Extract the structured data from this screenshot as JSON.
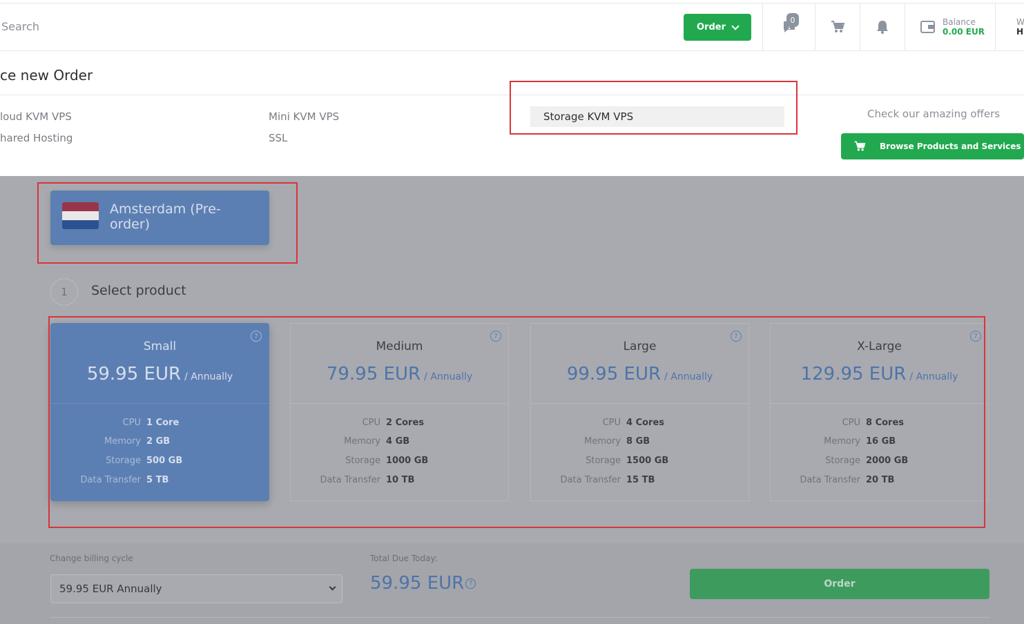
{
  "header": {
    "search_placeholder": "Search",
    "order_label": "Order",
    "messages_count": "0",
    "balance_label": "Balance",
    "balance_value": "0.00 EUR",
    "user_initial_top": "W",
    "user_initial_bottom": "H"
  },
  "page": {
    "title": "ce new Order"
  },
  "categories": {
    "col1": [
      "loud KVM VPS",
      "hared Hosting"
    ],
    "col2": [
      "Mini KVM VPS",
      "SSL"
    ],
    "active": "Storage KVM VPS"
  },
  "offers": {
    "text": "Check our amazing offers",
    "browse_label": "Browse Products and Services"
  },
  "location": {
    "name": "Amsterdam (Pre-order)",
    "flag_colors": [
      "#ae1c28",
      "#ffffff",
      "#21468b"
    ]
  },
  "step": {
    "number": "1",
    "title": "Select product"
  },
  "plans": [
    {
      "name": "Small",
      "price": "59.95 EUR",
      "period": "/ Annually",
      "cpu": "1 Core",
      "memory": "2 GB",
      "storage": "500 GB",
      "transfer": "5 TB"
    },
    {
      "name": "Medium",
      "price": "79.95 EUR",
      "period": "/ Annually",
      "cpu": "2 Cores",
      "memory": "4 GB",
      "storage": "1000 GB",
      "transfer": "10 TB"
    },
    {
      "name": "Large",
      "price": "99.95 EUR",
      "period": "/ Annually",
      "cpu": "4 Cores",
      "memory": "8 GB",
      "storage": "1500 GB",
      "transfer": "15 TB"
    },
    {
      "name": "X-Large",
      "price": "129.95 EUR",
      "period": "/ Annually",
      "cpu": "8 Cores",
      "memory": "16 GB",
      "storage": "2000 GB",
      "transfer": "20 TB"
    }
  ],
  "spec_labels": {
    "cpu": "CPU",
    "memory": "Memory",
    "storage": "Storage",
    "transfer": "Data Transfer"
  },
  "billing": {
    "label": "Change billing cycle",
    "selected": "59.95 EUR Annually",
    "total_label": "Total Due Today:",
    "total_value": "59.95 EUR",
    "order_label": "Order"
  },
  "help_glyph": "?",
  "colors": {
    "accent_green": "#22a94f",
    "plan_blue": "#5c7fb3",
    "highlight_red": "#d9343a"
  }
}
